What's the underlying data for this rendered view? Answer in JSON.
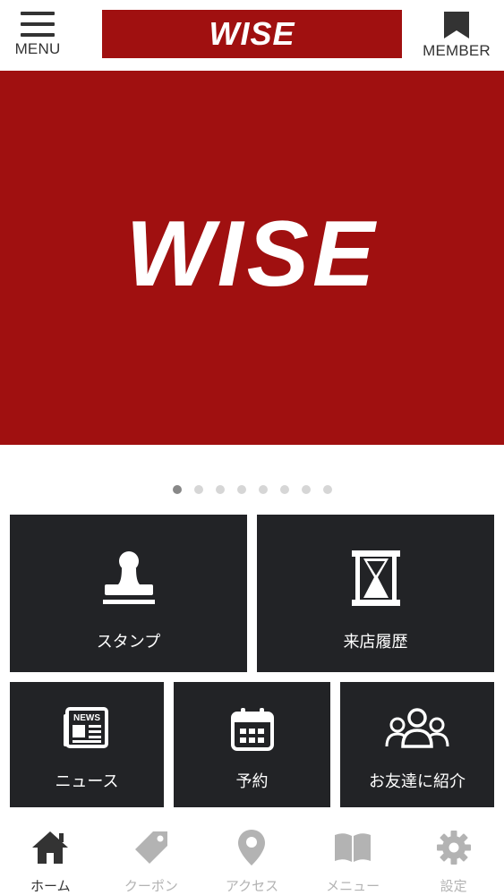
{
  "header": {
    "menu_label": "MENU",
    "logo_text": "WISE",
    "member_label": "MEMBER"
  },
  "hero": {
    "logo_text": "WISE",
    "slide_count": 8,
    "active_slide": 1
  },
  "tiles": {
    "stamp": "スタンプ",
    "history": "来店履歴",
    "news": "ニュース",
    "news_icon_text": "NEWS",
    "reserve": "予約",
    "friend": "お友達に紹介"
  },
  "tabbar": {
    "items": [
      {
        "label": "ホーム",
        "icon": "home-icon",
        "active": true
      },
      {
        "label": "クーポン",
        "icon": "tag-icon",
        "active": false
      },
      {
        "label": "アクセス",
        "icon": "map-pin-icon",
        "active": false
      },
      {
        "label": "メニュー",
        "icon": "book-icon",
        "active": false
      },
      {
        "label": "設定",
        "icon": "gear-icon",
        "active": false
      }
    ]
  },
  "colors": {
    "brand_red": "#a01010",
    "tile_bg": "#222326",
    "tab_active": "#333333",
    "tab_inactive": "#b3b3b3"
  }
}
